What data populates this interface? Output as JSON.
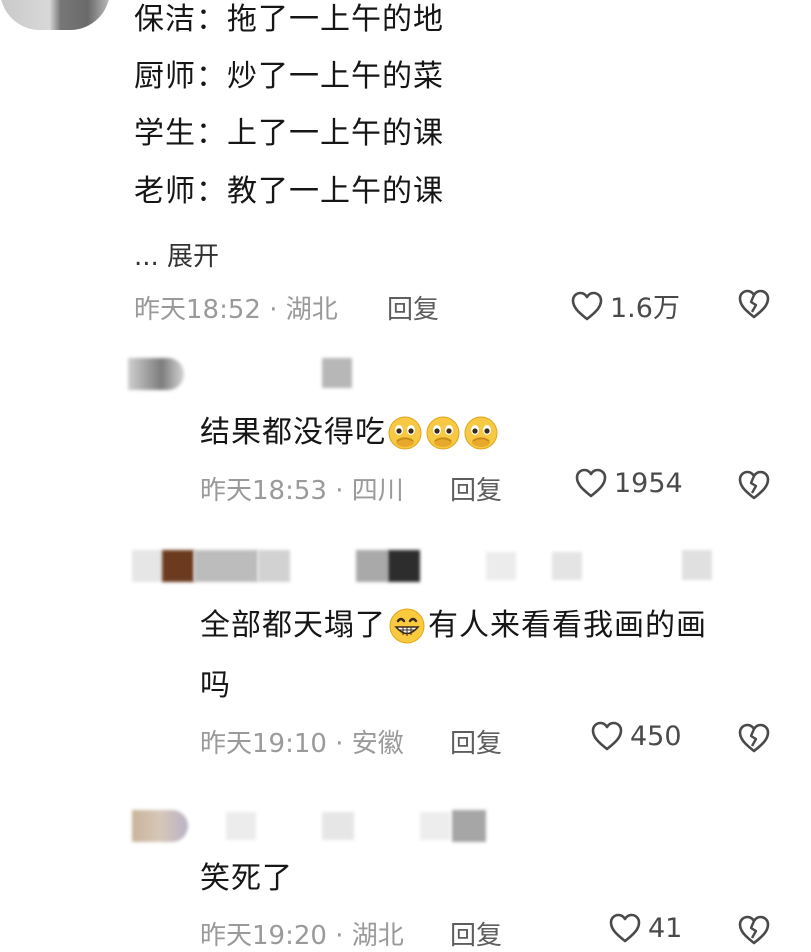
{
  "comments": [
    {
      "lines": [
        "保洁：拖了一上午的地",
        "厨师：炒了一上午的菜",
        "学生：上了一上午的课",
        "老师：教了一上午的课"
      ],
      "expand": "... 展开",
      "time": "昨天18:52 · 湖北",
      "reply": "回复",
      "likes": "1.6万"
    },
    {
      "text": "结果都没得吃",
      "emoji": [
        "pleading-face-icon",
        "pleading-face-icon",
        "pleading-face-icon"
      ],
      "time": "昨天18:53 · 四川",
      "reply": "回复",
      "likes": "1954"
    },
    {
      "text_a": "全部都天塌了",
      "emoji": "grinning-face-icon",
      "text_b": "有人来看看我画的画",
      "text_c": "吗",
      "time": "昨天19:10 · 安徽",
      "reply": "回复",
      "likes": "450"
    },
    {
      "text": "笑死了",
      "time": "昨天19:20 · 湖北",
      "reply": "回复",
      "likes": "41"
    }
  ]
}
